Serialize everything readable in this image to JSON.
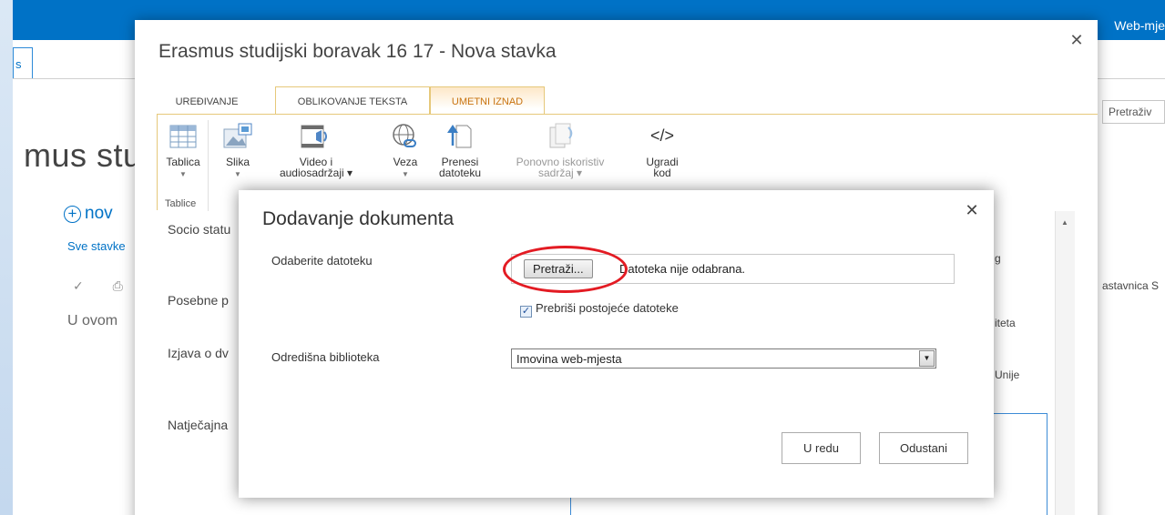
{
  "background": {
    "suite_link": "Web-mje",
    "tab_label": "s",
    "page_title": "mus stu",
    "new_link": "nov",
    "all_items": "Sve stavke",
    "row_icons": "✓ ⎙",
    "empty_text": "U ovom",
    "search_placeholder": "Pretraživ",
    "site_nav": "astavnica S"
  },
  "item_form": {
    "title": "Erasmus studijski boravak 16 17 - Nova stavka",
    "close": "✕",
    "ribbon_tabs": [
      "UREĐIVANJE",
      "OBLIKOVANJE TEKSTA",
      "UMETNI IZNAD"
    ],
    "ribbon_buttons": {
      "table": "Tablica",
      "image": "Slika",
      "video_line1": "Video i",
      "video_line2": "audiosadržaji ▾",
      "link": "Veza",
      "upload_line1": "Prenesi",
      "upload_line2": "datoteku",
      "reuse_line1": "Ponovno iskoristiv",
      "reuse_line2": "sadržaj ▾",
      "embed_line1": "Ugradi",
      "embed_line2": "kod",
      "embed_icon": "</>"
    },
    "ribbon_group": "Tablice",
    "fields": [
      "Socio statu",
      "Posebne p",
      "Izjava o dv",
      "Natječajna"
    ],
    "right_fields": [
      "g",
      "iteta",
      "Unije"
    ]
  },
  "dialog": {
    "title": "Dodavanje dokumenta",
    "close": "✕",
    "file_label": "Odaberite datoteku",
    "browse_label": "Pretraži...",
    "file_status": "Datoteka nije odabrana.",
    "overwrite_check": "✓",
    "overwrite_label": "Prebriši postojeće datoteke",
    "library_label": "Odredišna biblioteka",
    "library_value": "Imovina web-mjesta",
    "ok_label": "U redu",
    "cancel_label": "Odustani"
  },
  "colors": {
    "suite_bar": "#0072c6",
    "highlight_ring": "#e31b23",
    "active_tab_text": "#c8730f"
  }
}
